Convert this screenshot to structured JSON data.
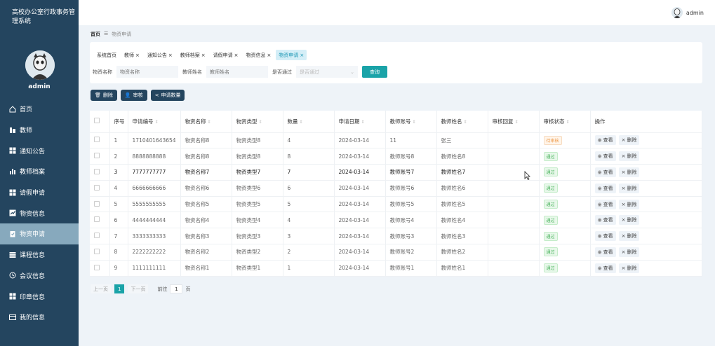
{
  "app": {
    "title": "高校办公室行政事务管理系统",
    "user": "admin"
  },
  "sidebar": {
    "items": [
      {
        "label": "首页",
        "icon": "home-icon"
      },
      {
        "label": "教师",
        "icon": "user-icon"
      },
      {
        "label": "通知公告",
        "icon": "grid-icon"
      },
      {
        "label": "教师档案",
        "icon": "bar-chart-icon"
      },
      {
        "label": "请假申请",
        "icon": "grid-icon"
      },
      {
        "label": "物资信息",
        "icon": "line-chart-icon"
      },
      {
        "label": "物资申请",
        "icon": "clipboard-icon",
        "active": true
      },
      {
        "label": "课程信息",
        "icon": "list-icon"
      },
      {
        "label": "会议信息",
        "icon": "clock-icon"
      },
      {
        "label": "印章信息",
        "icon": "grid-icon"
      },
      {
        "label": "我的信息",
        "icon": "id-card-icon"
      }
    ]
  },
  "breadcrumb": {
    "home": "首页",
    "sep": "☰",
    "current": "物资申请"
  },
  "tabs": [
    {
      "label": "系统首页",
      "closable": false
    },
    {
      "label": "教师",
      "closable": true
    },
    {
      "label": "通知公告",
      "closable": true
    },
    {
      "label": "教师档案",
      "closable": true
    },
    {
      "label": "请假申请",
      "closable": true
    },
    {
      "label": "物资信息",
      "closable": true
    },
    {
      "label": "物资申请",
      "closable": true,
      "active": true
    }
  ],
  "search": {
    "name_label": "物资名称",
    "name_placeholder": "物资名称",
    "teacher_label": "教师姓名",
    "teacher_placeholder": "教师姓名",
    "pass_label": "是否通过",
    "pass_placeholder": "是否通过",
    "query_button": "查询"
  },
  "actions": {
    "delete": "删除",
    "review": "审核",
    "count": "申请数量"
  },
  "table": {
    "headers": [
      "序号",
      "申请编号",
      "物资名称",
      "物资类型",
      "数量",
      "申请日期",
      "教师账号",
      "教师姓名",
      "审核回复",
      "审核状态",
      "操作"
    ],
    "rows": [
      {
        "no": "1",
        "code": "1710401643654",
        "name": "物资名称8",
        "type": "物资类型8",
        "qty": "4",
        "date": "2024-03-14",
        "account": "11",
        "teacher": "张三",
        "reply": "",
        "status": "待审核",
        "status_kind": "pending"
      },
      {
        "no": "2",
        "code": "8888888888",
        "name": "物资名称8",
        "type": "物资类型8",
        "qty": "8",
        "date": "2024-03-14",
        "account": "教师账号8",
        "teacher": "教师姓名8",
        "reply": "",
        "status": "通过",
        "status_kind": "pass"
      },
      {
        "no": "3",
        "code": "7777777777",
        "name": "物资名称7",
        "type": "物资类型7",
        "qty": "7",
        "date": "2024-03-14",
        "account": "教师账号7",
        "teacher": "教师姓名7",
        "reply": "",
        "status": "通过",
        "status_kind": "pass"
      },
      {
        "no": "4",
        "code": "6666666666",
        "name": "物资名称6",
        "type": "物资类型6",
        "qty": "6",
        "date": "2024-03-14",
        "account": "教师账号6",
        "teacher": "教师姓名6",
        "reply": "",
        "status": "通过",
        "status_kind": "pass"
      },
      {
        "no": "5",
        "code": "5555555555",
        "name": "物资名称5",
        "type": "物资类型5",
        "qty": "5",
        "date": "2024-03-14",
        "account": "教师账号5",
        "teacher": "教师姓名5",
        "reply": "",
        "status": "通过",
        "status_kind": "pass"
      },
      {
        "no": "6",
        "code": "4444444444",
        "name": "物资名称4",
        "type": "物资类型4",
        "qty": "4",
        "date": "2024-03-14",
        "account": "教师账号4",
        "teacher": "教师姓名4",
        "reply": "",
        "status": "通过",
        "status_kind": "pass"
      },
      {
        "no": "7",
        "code": "3333333333",
        "name": "物资名称3",
        "type": "物资类型3",
        "qty": "3",
        "date": "2024-03-14",
        "account": "教师账号3",
        "teacher": "教师姓名3",
        "reply": "",
        "status": "通过",
        "status_kind": "pass"
      },
      {
        "no": "8",
        "code": "2222222222",
        "name": "物资名称2",
        "type": "物资类型2",
        "qty": "2",
        "date": "2024-03-14",
        "account": "教师账号2",
        "teacher": "教师姓名2",
        "reply": "",
        "status": "通过",
        "status_kind": "pass"
      },
      {
        "no": "9",
        "code": "1111111111",
        "name": "物资名称1",
        "type": "物资类型1",
        "qty": "1",
        "date": "2024-03-14",
        "account": "教师账号1",
        "teacher": "教师姓名1",
        "reply": "",
        "status": "通过",
        "status_kind": "pass"
      }
    ],
    "view_label": "查看",
    "delete_label": "删除"
  },
  "pager": {
    "prev": "上一页",
    "current": "1",
    "next": "下一页",
    "goto_label": "前往",
    "goto_value": "1",
    "page_suffix": "页"
  },
  "colors": {
    "sidebar": "#24455f",
    "active_menu": "#87a9bd",
    "accent": "#1aa3a8",
    "tab_active": "#d4eef7"
  }
}
